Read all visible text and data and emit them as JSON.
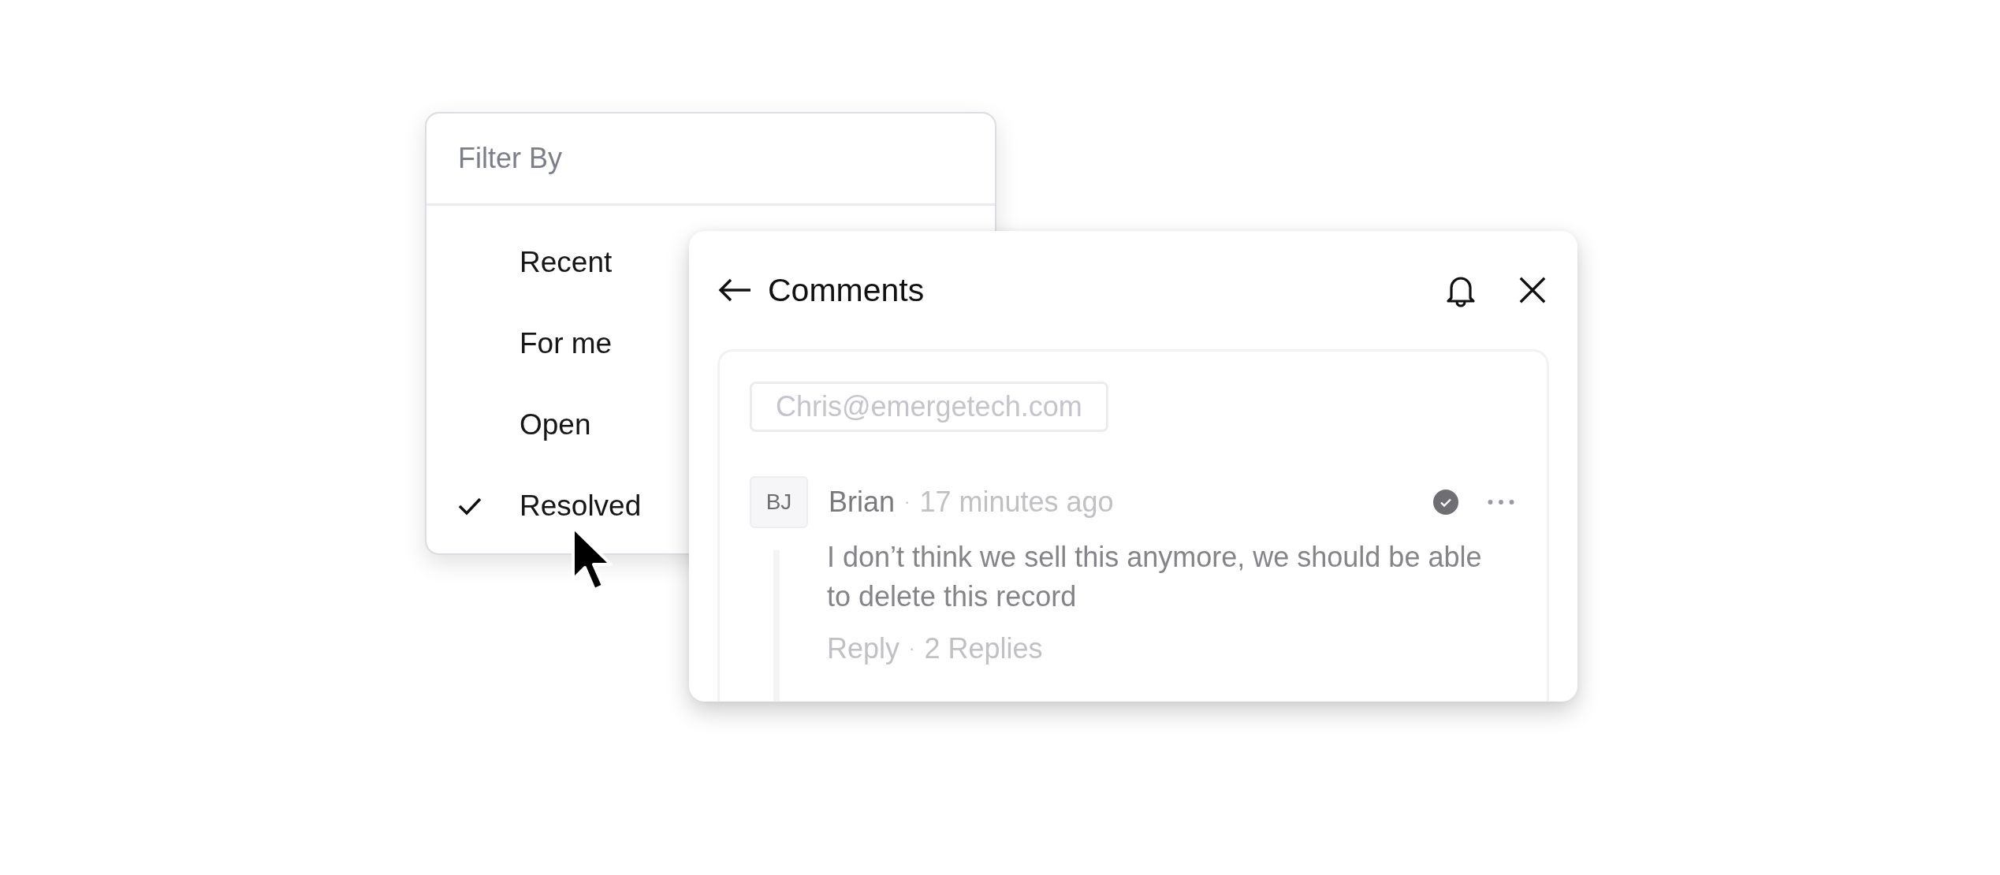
{
  "filter_menu": {
    "title": "Filter By",
    "items": [
      {
        "label": "Recent",
        "selected": false
      },
      {
        "label": "For me",
        "selected": false
      },
      {
        "label": "Open",
        "selected": false
      },
      {
        "label": "Resolved",
        "selected": true
      }
    ]
  },
  "comments_panel": {
    "title": "Comments",
    "mention": "Chris@emergetech.com",
    "comment": {
      "initials": "BJ",
      "author": "Brian",
      "meta_separator": "·",
      "time": "17 minutes ago",
      "resolved": true,
      "text": "I don’t think we sell this anymore, we should be able to delete this record",
      "reply": "Reply",
      "actions_separator": "·",
      "replies": "2 Replies"
    }
  }
}
